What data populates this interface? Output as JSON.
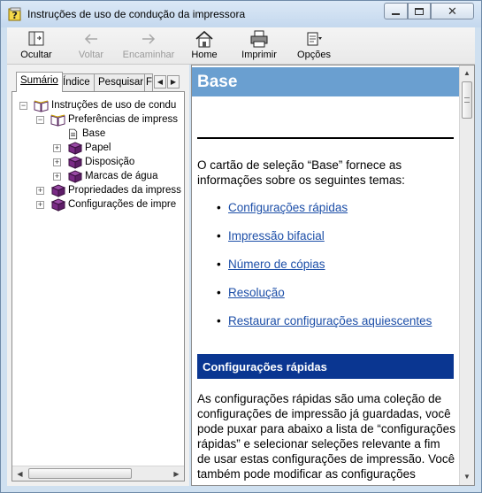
{
  "window": {
    "title": "Instruções de uso de condução da impressora"
  },
  "toolbar": {
    "buttons": [
      {
        "label": "Ocultar",
        "icon": "hide-pane-icon",
        "enabled": true
      },
      {
        "label": "Voltar",
        "icon": "back-arrow-icon",
        "enabled": false
      },
      {
        "label": "Encaminhar",
        "icon": "forward-arrow-icon",
        "enabled": false
      },
      {
        "label": "Home",
        "icon": "home-icon",
        "enabled": true
      },
      {
        "label": "Imprimir",
        "icon": "printer-icon",
        "enabled": true
      },
      {
        "label": "Opções",
        "icon": "options-icon",
        "enabled": true
      }
    ]
  },
  "nav_tabs": {
    "items": [
      "Sumário",
      "Índice",
      "Pesquisar",
      "F"
    ],
    "active": "Sumário"
  },
  "tree": {
    "items": [
      {
        "label": "Instruções de uso de condu",
        "level": 0,
        "expander": "−",
        "icon": "open-book-icon"
      },
      {
        "label": "Preferências de impress",
        "level": 1,
        "expander": "−",
        "icon": "open-book-icon"
      },
      {
        "label": "Base",
        "level": 2,
        "expander": "",
        "icon": "page-icon"
      },
      {
        "label": "Papel",
        "level": 2,
        "expander": "+",
        "icon": "closed-book-icon"
      },
      {
        "label": "Disposição",
        "level": 2,
        "expander": "+",
        "icon": "closed-book-icon"
      },
      {
        "label": "Marcas de água",
        "level": 2,
        "expander": "+",
        "icon": "closed-book-icon"
      },
      {
        "label": "Propriedades da impress",
        "level": 1,
        "expander": "+",
        "icon": "closed-book-icon"
      },
      {
        "label": "Configurações de impre",
        "level": 1,
        "expander": "+",
        "icon": "closed-book-icon"
      }
    ]
  },
  "content": {
    "header": "Base",
    "intro": "O cartão de seleção “Base” fornece as informações sobre os seguintes temas:",
    "topics": [
      "Configurações rápidas",
      "Impressão bifacial",
      "Número de cópias",
      "Resolução",
      "Restaurar configurações aquiescentes"
    ],
    "section_title": "Configurações rápidas",
    "section_text": "As configurações rápidas são uma coleção de configurações de impressão já guardadas, você pode puxar para abaixo a lista de “configurações rápidas” e selecionar seleções relevante a fim de usar estas configurações de impressão. Você também pode modificar as configurações"
  },
  "colors": {
    "header_bg": "#6a9fd0",
    "section_bg": "#0a3691",
    "link": "#1d4fa8",
    "book_purple": "#7a2a86"
  }
}
